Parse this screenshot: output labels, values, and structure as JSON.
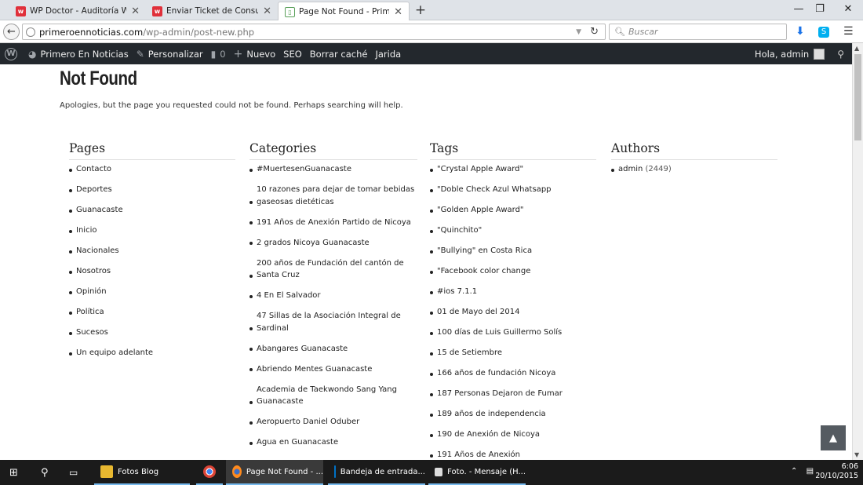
{
  "browser": {
    "tabs": [
      {
        "label": "WP Doctor - Auditoría Wo...",
        "favicon": "w"
      },
      {
        "label": "Enviar Ticket de Consulta ...",
        "favicon": "w"
      },
      {
        "label": "Page Not Found - Primero...",
        "favicon": "page"
      }
    ],
    "url_domain": "primeroennoticias.com",
    "url_path": "/wp-admin/post-new.php",
    "search_placeholder": "Buscar"
  },
  "adminbar": {
    "site": "Primero En Noticias",
    "customize": "Personalizar",
    "comments": "0",
    "new": "Nuevo",
    "seo": "SEO",
    "cache": "Borrar caché",
    "jarida": "Jarida",
    "greeting": "Hola, admin"
  },
  "page": {
    "title": "Not Found",
    "message": "Apologies, but the page you requested could not be found. Perhaps searching will help."
  },
  "widgets": {
    "pages": {
      "title": "Pages",
      "items": [
        "Contacto",
        "Deportes",
        "Guanacaste",
        "Inicio",
        "Nacionales",
        "Nosotros",
        "Opinión",
        "Política",
        "Sucesos",
        "Un equipo adelante"
      ]
    },
    "categories": {
      "title": "Categories",
      "items": [
        "#MuertesenGuanacaste",
        "10 razones para dejar de tomar bebidas gaseosas dietéticas",
        "191 Años de Anexión Partido de Nicoya",
        "2 grados Nicoya Guanacaste",
        "200 años de Fundación del cantón de Santa Cruz",
        "4 En El Salvador",
        "47 Sillas de la Asociación Integral de Sardinal",
        "Abangares Guanacaste",
        "Abriendo Mentes Guanacaste",
        "Academia de Taekwondo Sang Yang Guanacaste",
        "Aeropuerto Daniel Oduber",
        "Agua en Guanacaste"
      ]
    },
    "tags": {
      "title": "Tags",
      "items": [
        "\"Crystal Apple Award\"",
        "\"Doble Check Azul Whatsapp",
        "\"Golden Apple Award\"",
        "\"Quinchito\"",
        "\"Bullying\" en Costa Rica",
        "\"Facebook color change",
        "#ios 7.1.1",
        "01 de Mayo del 2014",
        "100 días de Luis Guillermo Solís",
        "15 de Setiembre",
        "166 años de fundación Nicoya",
        "187 Personas Dejaron de Fumar",
        "189 años de independencia",
        "190 de Anexión de Nicoya",
        "191 Años de Anexión"
      ]
    },
    "authors": {
      "title": "Authors",
      "items": [
        {
          "name": "admin",
          "count": "(2449)"
        }
      ]
    }
  },
  "taskbar": {
    "apps": [
      {
        "label": "Fotos Blog",
        "icon": "folder-icon"
      },
      {
        "label": "",
        "icon": "chrome-icon"
      },
      {
        "label": "Page Not Found - ...",
        "icon": "firefox-icon"
      },
      {
        "label": "Bandeja de entrada...",
        "icon": "outlook-icon"
      },
      {
        "label": "Foto. - Mensaje (H...",
        "icon": "mail-icon"
      }
    ],
    "time": "6:06",
    "date": "20/10/2015"
  }
}
